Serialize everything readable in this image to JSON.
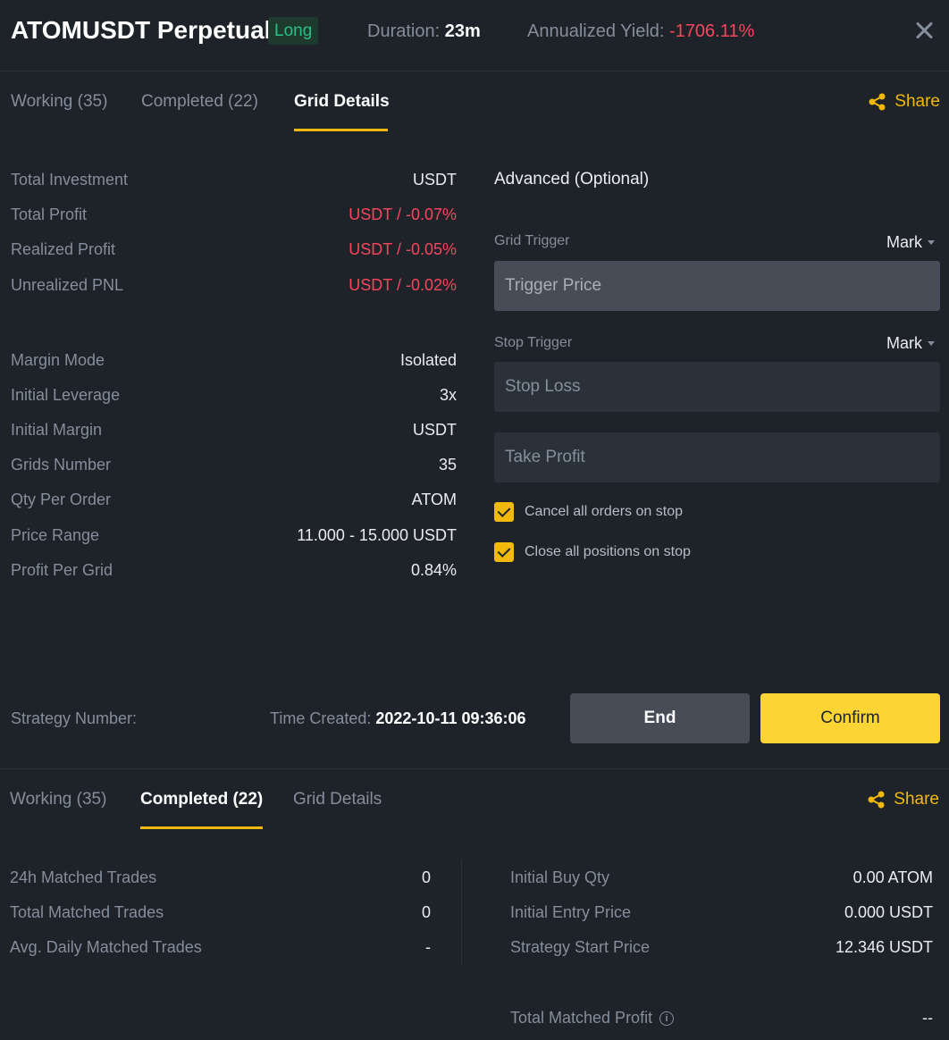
{
  "header": {
    "title": "ATOMUSDT Perpetual",
    "badge": "Long",
    "duration_label": "Duration:",
    "duration_value": "23m",
    "yield_label": "Annualized Yield:",
    "yield_value": "-1706.11%"
  },
  "tabs_top": [
    {
      "label": "Working (35)"
    },
    {
      "label": "Completed (22)"
    },
    {
      "label": "Grid Details",
      "active": true
    }
  ],
  "share_label": "Share",
  "details": {
    "rows_a": [
      {
        "label": "Total Investment",
        "value": "USDT",
        "status": "normal"
      },
      {
        "label": "Total Profit",
        "value": "USDT / -0.07%",
        "status": "negative"
      },
      {
        "label": "Realized Profit",
        "value": "USDT / -0.05%",
        "status": "negative"
      },
      {
        "label": "Unrealized PNL",
        "value": "USDT / -0.02%",
        "status": "negative"
      }
    ],
    "rows_b": [
      {
        "label": "Margin Mode",
        "value": "Isolated"
      },
      {
        "label": "Initial Leverage",
        "value": "3x"
      },
      {
        "label": "Initial Margin",
        "value": "USDT"
      },
      {
        "label": "Grids Number",
        "value": "35"
      },
      {
        "label": "Qty Per Order",
        "value": "ATOM"
      },
      {
        "label": "Price Range",
        "value": "11.000 - 15.000 USDT"
      },
      {
        "label": "Profit Per Grid",
        "value": "0.84%"
      }
    ]
  },
  "advanced": {
    "title": "Advanced (Optional)",
    "grid_trigger_label": "Grid Trigger",
    "grid_trigger_mode": "Mark",
    "trigger_price_placeholder": "Trigger Price",
    "stop_trigger_label": "Stop Trigger",
    "stop_trigger_mode": "Mark",
    "stop_loss_placeholder": "Stop Loss",
    "take_profit_placeholder": "Take Profit",
    "cancel_orders_label": "Cancel all orders on stop",
    "cancel_orders_checked": true,
    "close_positions_label": "Close all positions on stop",
    "close_positions_checked": true
  },
  "footer": {
    "strategy_number_label": "Strategy Number:",
    "time_created_label": "Time Created:",
    "time_created_value": "2022-10-11 09:36:06",
    "end_label": "End",
    "confirm_label": "Confirm"
  },
  "tabs_bottom": [
    {
      "label": "Working (35)"
    },
    {
      "label": "Completed (22)",
      "active": true
    },
    {
      "label": "Grid Details"
    }
  ],
  "completed": {
    "left": [
      {
        "label": "24h Matched Trades",
        "value": "0"
      },
      {
        "label": "Total Matched Trades",
        "value": "0"
      },
      {
        "label": "Avg. Daily Matched Trades",
        "value": "-"
      }
    ],
    "right": [
      {
        "label": "Initial Buy Qty",
        "value": "0.00 ATOM"
      },
      {
        "label": "Initial Entry Price",
        "value": "0.000 USDT"
      },
      {
        "label": "Strategy Start Price",
        "value": "12.346 USDT"
      }
    ],
    "total_matched_profit_label": "Total Matched Profit",
    "total_matched_profit_value": "--"
  },
  "colors": {
    "background": "#1e2329",
    "accent": "#f0b90b",
    "negative": "#f6465d",
    "positive": "#2ebd85"
  }
}
